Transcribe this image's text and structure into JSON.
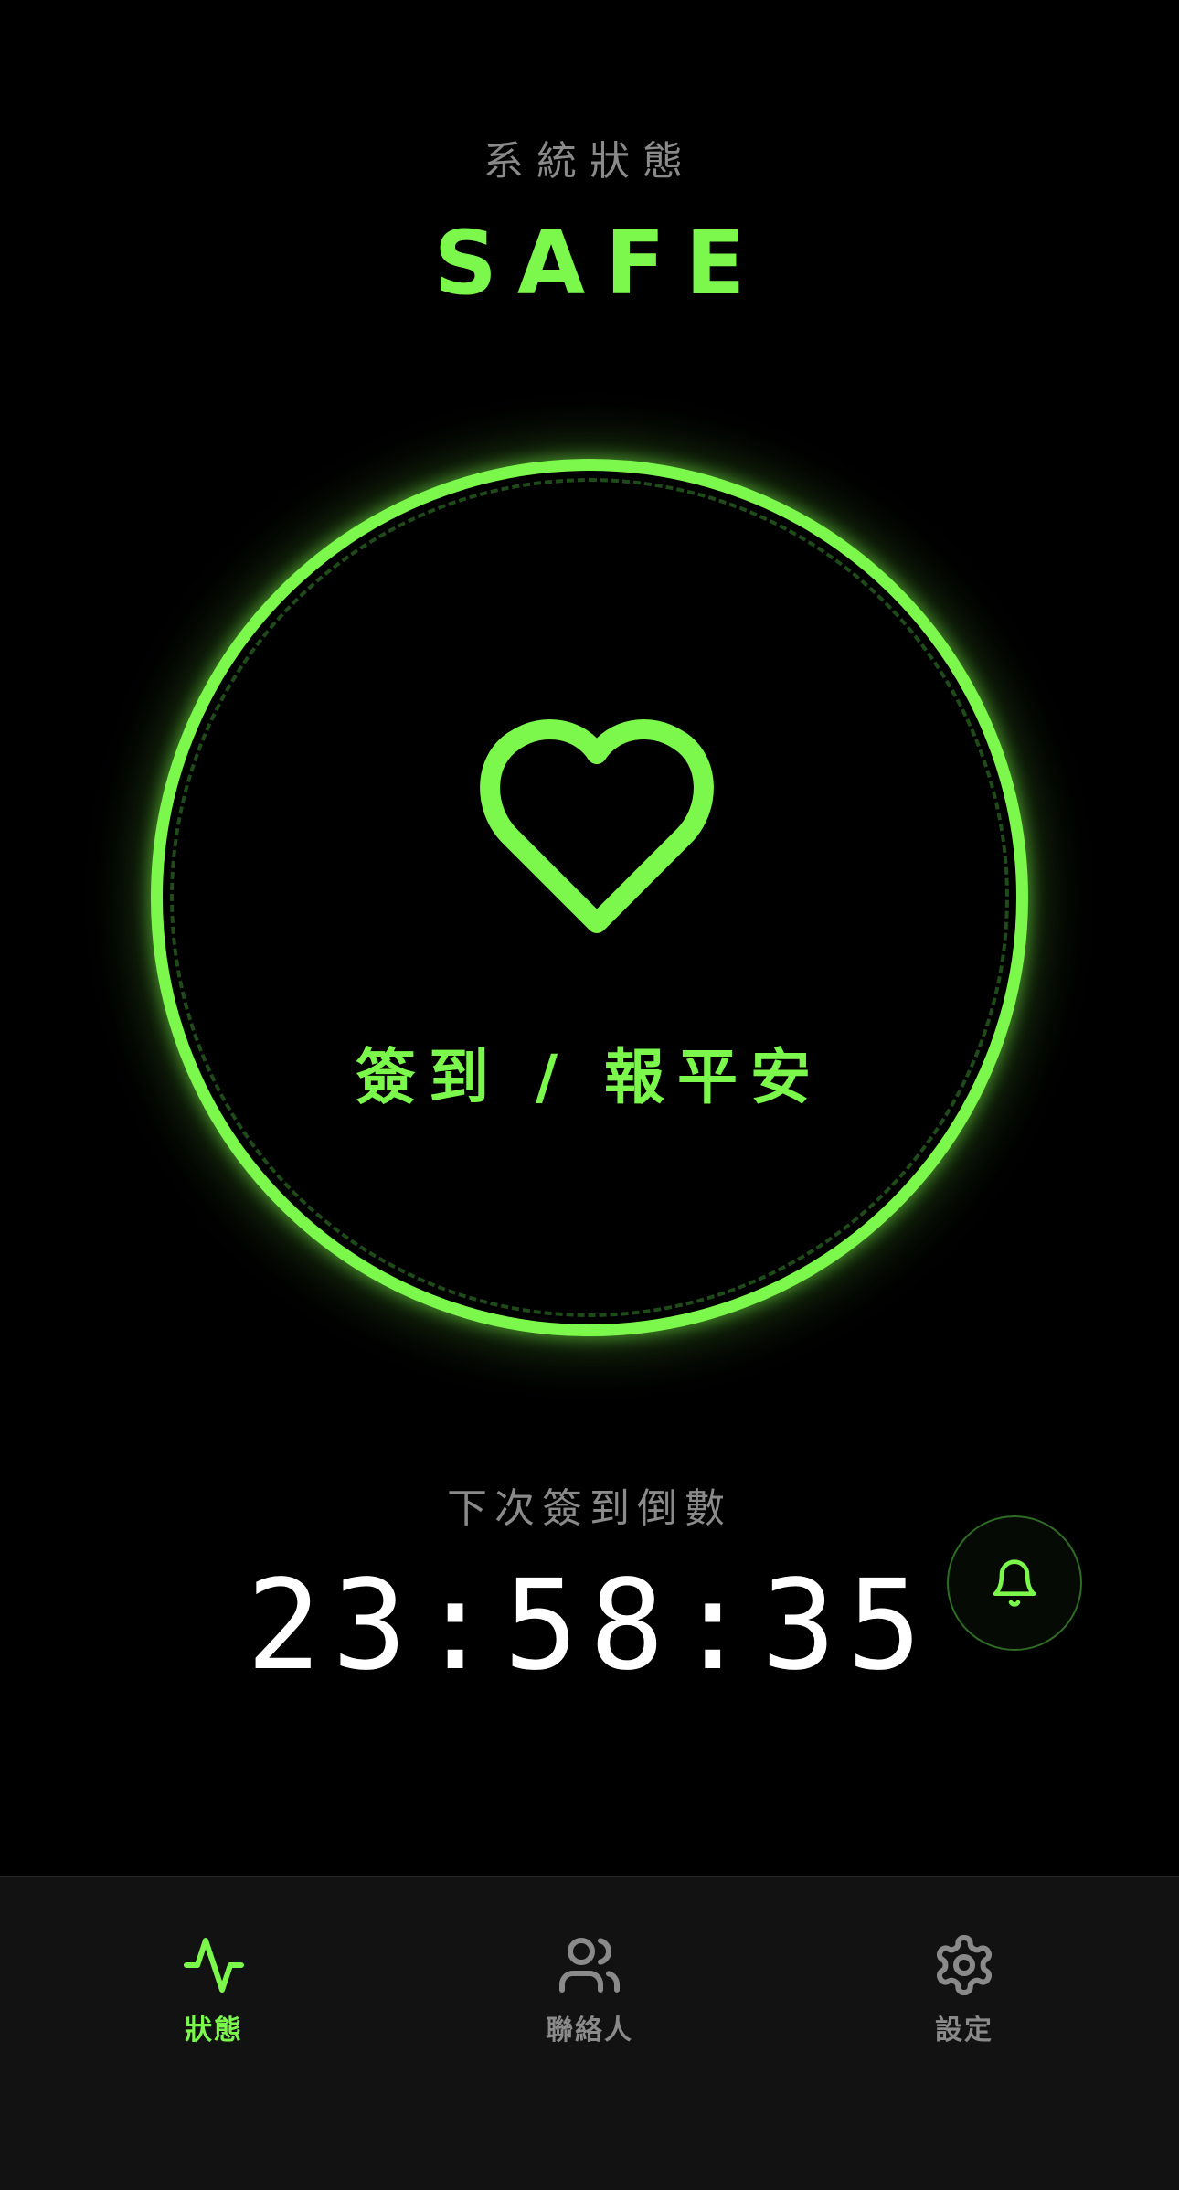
{
  "header": {
    "status_label": "系統狀態",
    "status_value": "SAFE"
  },
  "checkin": {
    "icon": "heart-icon",
    "label": "簽到 / 報平安"
  },
  "countdown": {
    "label": "下次簽到倒數",
    "value": "23:58:35"
  },
  "reminder": {
    "icon": "bell-icon"
  },
  "tabs": [
    {
      "label": "狀態",
      "icon": "activity-icon",
      "active": true
    },
    {
      "label": "聯絡人",
      "icon": "users-icon",
      "active": false
    },
    {
      "label": "設定",
      "icon": "gear-icon",
      "active": false
    }
  ],
  "colors": {
    "accent": "#7cf84c",
    "background": "#000000",
    "muted_text": "#8a8a8a",
    "tab_bar": "#121212"
  }
}
